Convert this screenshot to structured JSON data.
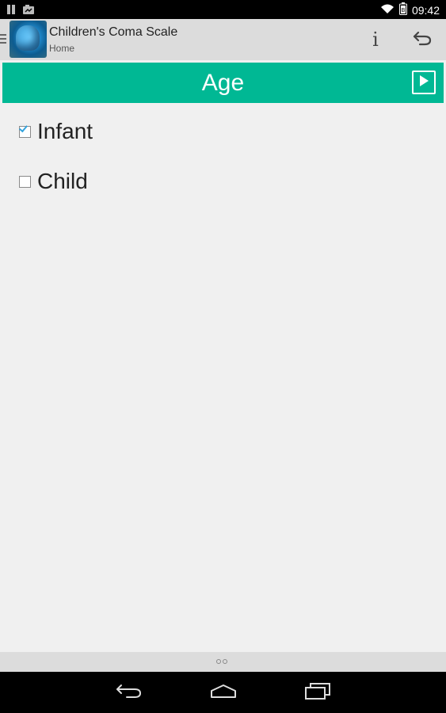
{
  "status_bar": {
    "time": "09:42",
    "icons": [
      "notification-icon",
      "photo-notification-icon",
      "wifi-icon",
      "battery-icon"
    ]
  },
  "action_bar": {
    "title": "Children's Coma Scale",
    "subtitle": "Home",
    "info_label": "i",
    "icons": [
      "menu-icon",
      "app-icon",
      "info-icon",
      "undo-icon"
    ]
  },
  "section": {
    "title": "Age",
    "accent_color": "#00b894",
    "next_icon": "play-icon"
  },
  "options": [
    {
      "label": "Infant",
      "checked": true
    },
    {
      "label": "Child",
      "checked": false
    }
  ],
  "pager": {
    "pages": 2,
    "current": 1
  },
  "nav_bar": {
    "buttons": [
      "back-icon",
      "home-icon",
      "recents-icon"
    ]
  }
}
